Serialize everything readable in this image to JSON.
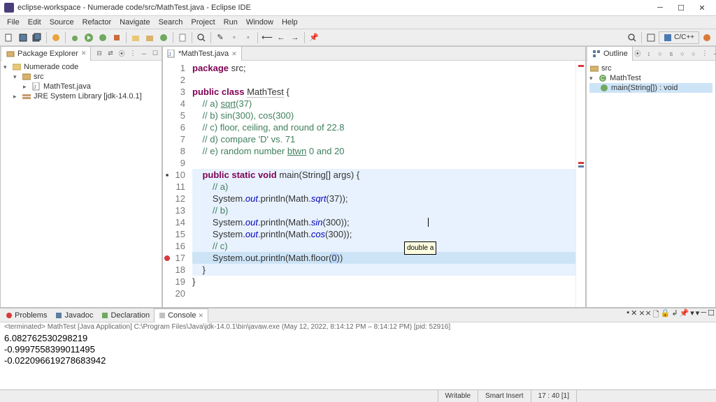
{
  "window": {
    "title": "eclipse-workspace - Numerade code/src/MathTest.java - Eclipse IDE"
  },
  "menu": [
    "File",
    "Edit",
    "Source",
    "Refactor",
    "Navigate",
    "Search",
    "Project",
    "Run",
    "Window",
    "Help"
  ],
  "perspective": "C/C++",
  "explorer": {
    "title": "Package Explorer",
    "root": "Numerade code",
    "src": "src",
    "file": "MathTest.java",
    "lib": "JRE System Library [jdk-14.0.1]"
  },
  "editor": {
    "tab": "*MathTest.java",
    "tooltip": "double a",
    "code": {
      "l1": {
        "pre": "",
        "kw": "package",
        "rest": " src;"
      },
      "l2": "",
      "l3": {
        "kw1": "public",
        "kw2": "class",
        "name": "MathTest",
        "rest": " {"
      },
      "l4": "    // a) sqrt(37)",
      "l5": "    // b) sin(300), cos(300)",
      "l6": "    // c) floor, ceiling, and round of 22.8",
      "l7": "    // d) compare 'D' vs. 71",
      "l8": "    // e) random number btwn 0 and 20",
      "l9": "",
      "l10": {
        "pre": "    ",
        "kw1": "public",
        "kw2": "static",
        "kw3": "void",
        "name": "main",
        "args": "(String[] args)",
        "rest": " {"
      },
      "l11": "        // a)",
      "l12": {
        "pre": "        System.",
        "st1": "out",
        "mid1": ".println(Math.",
        "st2": "sqrt",
        "rest": "(37));"
      },
      "l13": "        // b)",
      "l14": {
        "pre": "        System.",
        "st1": "out",
        "mid1": ".println(Math.",
        "st2": "sin",
        "rest": "(300));"
      },
      "l15": {
        "pre": "        System.",
        "st1": "out",
        "mid1": ".println(Math.",
        "st2": "cos",
        "rest": "(300));"
      },
      "l16": "        // c)",
      "l17": {
        "pre": "        System.out.println(Math.floor(",
        "sel": "0",
        "rest": "))"
      },
      "l18": "    }",
      "l19": "}",
      "l20": ""
    }
  },
  "outline": {
    "title": "Outline",
    "pkg": "src",
    "class": "MathTest",
    "method": "main(String[]) : void"
  },
  "bottom": {
    "tabs": [
      "Problems",
      "Javadoc",
      "Declaration",
      "Console"
    ],
    "desc": "<terminated> MathTest [Java Application] C:\\Program Files\\Java\\jdk-14.0.1\\bin\\javaw.exe (May 12, 2022, 8:14:12 PM – 8:14:12 PM) [pid: 52916]",
    "out": [
      "6.082762530298219",
      "-0.9997558399011495",
      "-0.022096619278683942"
    ]
  },
  "status": {
    "writable": "Writable",
    "insert": "Smart Insert",
    "pos": "17 : 40 [1]"
  }
}
